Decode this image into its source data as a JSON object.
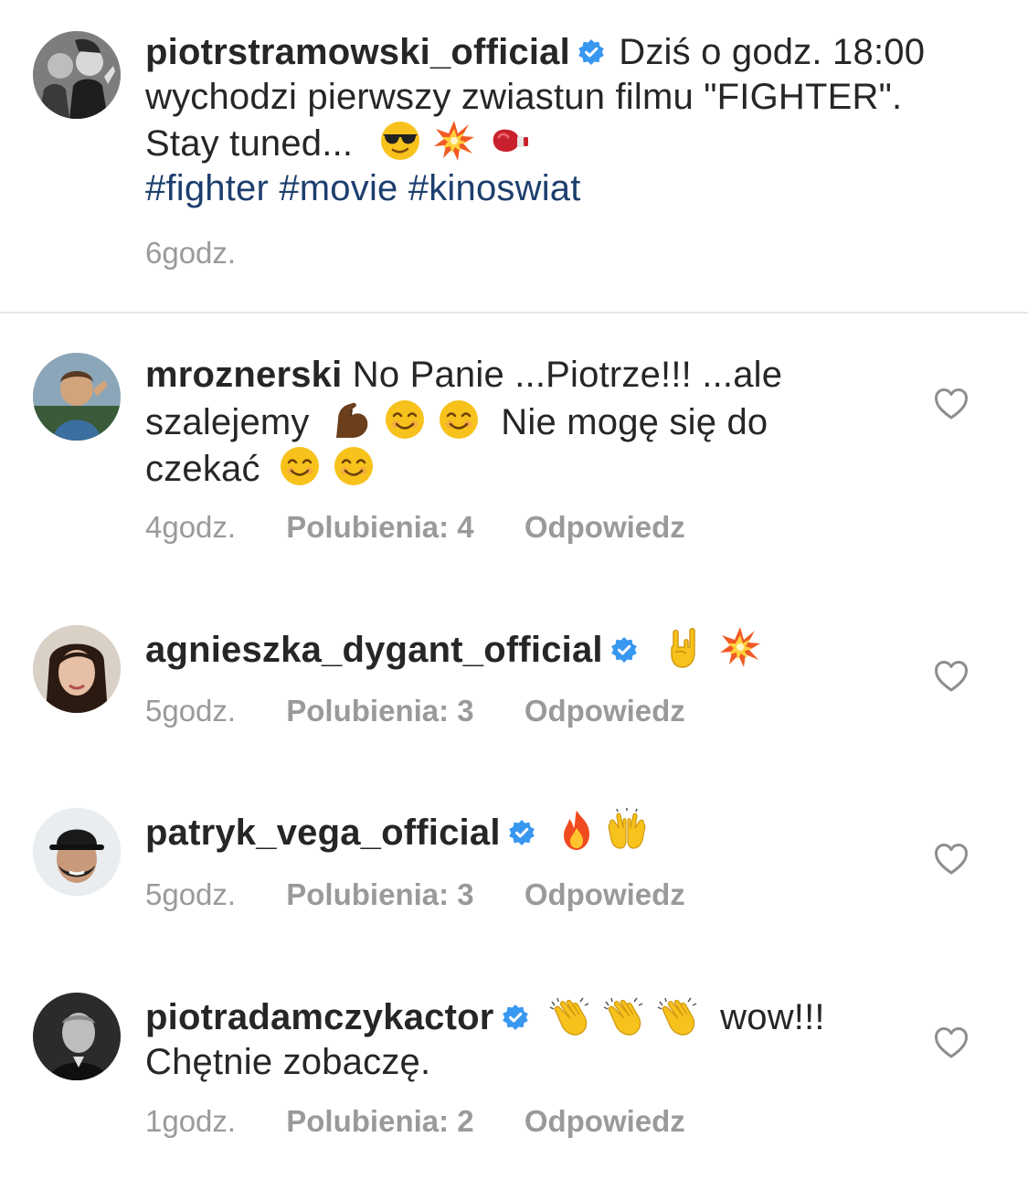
{
  "caption": {
    "username": "piotrstramowski_official",
    "verified": true,
    "text_line1": "Dziś o godz. 18:00",
    "text_line2": "wychodzi pierwszy zwiastun filmu \"FIGHTER\".",
    "text_line3": "Stay tuned...",
    "emojis": [
      "sunglasses-emoji",
      "collision-emoji",
      "boxing-glove-emoji"
    ],
    "hashtags": "#fighter #movie #kinoswiat",
    "time": "6godz."
  },
  "comments": [
    {
      "username": "mroznerski",
      "verified": false,
      "text_a": "No Panie ...Piotrze!!! ...ale",
      "text_b": "szalejemy",
      "text_c": "Nie mogę się do",
      "text_d": "czekać",
      "emojis": [
        "flexed-biceps-emoji",
        "smiling-emoji",
        "smiling-emoji",
        "smiling-emoji",
        "smiling-emoji"
      ],
      "time": "4godz.",
      "likes": "Polubienia: 4",
      "reply": "Odpowiedz"
    },
    {
      "username": "agnieszka_dygant_official",
      "verified": true,
      "emojis": [
        "rock-hand-emoji",
        "collision-emoji"
      ],
      "time": "5godz.",
      "likes": "Polubienia: 3",
      "reply": "Odpowiedz"
    },
    {
      "username": "patryk_vega_official",
      "verified": true,
      "emojis": [
        "fire-emoji",
        "raising-hands-emoji"
      ],
      "time": "5godz.",
      "likes": "Polubienia: 3",
      "reply": "Odpowiedz"
    },
    {
      "username": "piotradamczykactor",
      "verified": true,
      "text_a": "wow!!!",
      "text_b": "Chętnie zobaczę.",
      "emojis": [
        "clapping-hands-emoji",
        "clapping-hands-emoji",
        "clapping-hands-emoji"
      ],
      "time": "1godz.",
      "likes": "Polubienia: 2",
      "reply": "Odpowiedz"
    }
  ],
  "colors": {
    "text": "#262626",
    "meta": "#9a9a9a",
    "hashtag": "#1d3f6e",
    "verified": "#3897f0",
    "divider": "#e6e6e6"
  }
}
